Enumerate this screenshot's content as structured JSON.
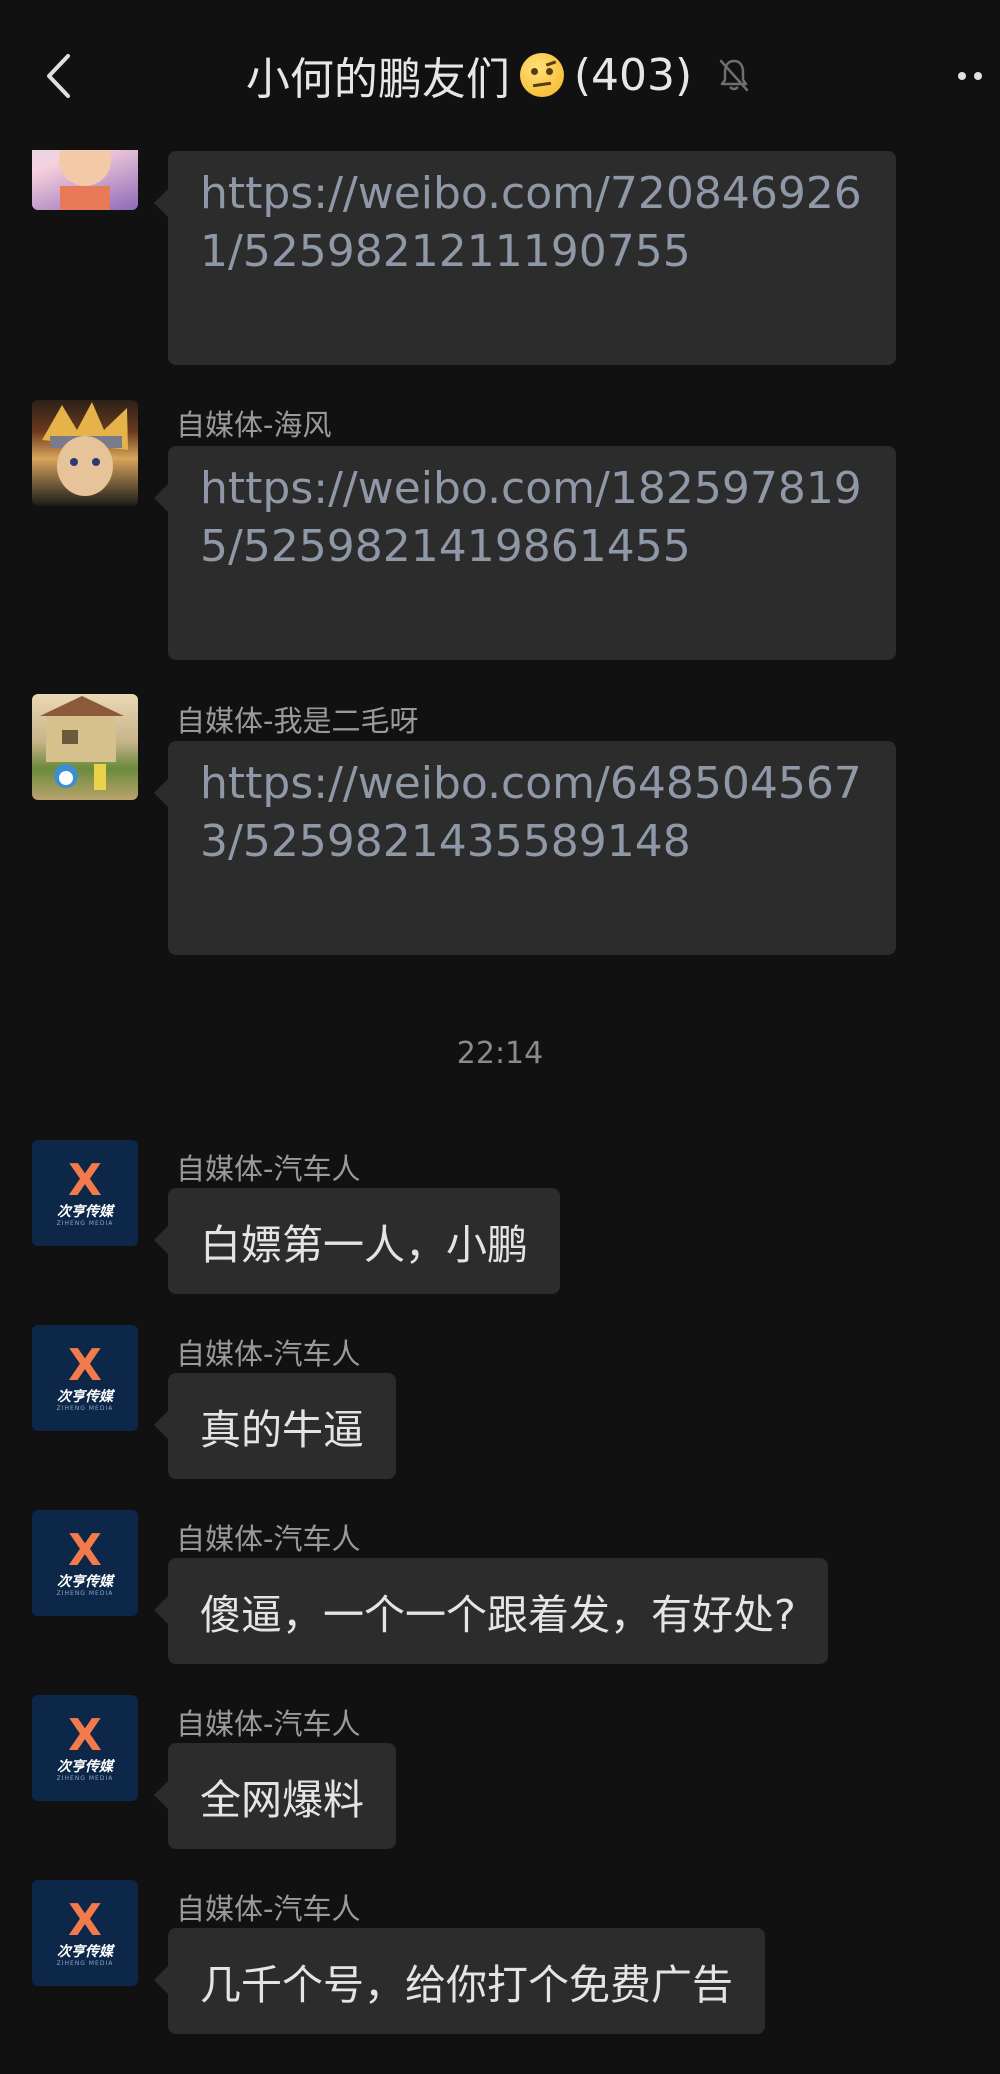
{
  "header": {
    "title": "小何的鹏友们",
    "member_count": "(403)",
    "back_icon": "chevron-left-icon",
    "mute_icon": "bell-off-icon",
    "more_icon": "more-dots-icon",
    "emoji": "raised-eyebrow-face"
  },
  "messages_top": [
    {
      "sender": "",
      "text": "https://weibo.com/7208469261/5259821211190755"
    },
    {
      "sender": "自媒体-海风",
      "text": "https://weibo.com/1825978195/5259821419861455"
    },
    {
      "sender": "自媒体-我是二毛呀",
      "text": "https://weibo.com/6485045673/5259821435589148"
    }
  ],
  "time_separator": "22:14",
  "messages_bottom": [
    {
      "sender": "自媒体-汽车人",
      "text": "白嫖第一人，小鹏"
    },
    {
      "sender": "自媒体-汽车人",
      "text": "真的牛逼"
    },
    {
      "sender": "自媒体-汽车人",
      "text": "傻逼，一个一个跟着发，有好处?"
    },
    {
      "sender": "自媒体-汽车人",
      "text": "全网爆料"
    },
    {
      "sender": "自媒体-汽车人",
      "text": "几千个号，给你打个免费广告"
    }
  ],
  "brand_avatar": {
    "mark": "X",
    "name": "次亨传媒",
    "sub": "ZIHENG MEDIA"
  },
  "colors": {
    "background": "#111111",
    "bubble": "#2c2c2c",
    "link_text": "#8f98a6",
    "brand_bg": "#0c2748",
    "brand_accent": "#f27a4b"
  }
}
